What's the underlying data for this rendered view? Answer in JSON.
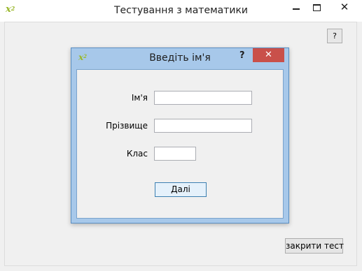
{
  "main_window": {
    "title": "Тестування з математики",
    "icon_base": "x",
    "icon_exponent": "2",
    "controls": {
      "minimize": "minimize-icon",
      "maximize": "maximize-icon",
      "close": "close-icon",
      "close_glyph": "✕"
    },
    "help_button_label": "?",
    "close_test_button_label": "закрити тест"
  },
  "dialog": {
    "title": "Введіть ім'я",
    "icon_base": "x",
    "icon_exponent": "2",
    "help_glyph": "?",
    "close_glyph": "✕",
    "colors": {
      "titlebar": "#a7c8ea",
      "close_button": "#c9504a",
      "icon_accent": "#9ab82b"
    },
    "fields": {
      "name_label": "Ім'я",
      "name_value": "",
      "surname_label": "Прізвище",
      "surname_value": "",
      "class_label": "Клас",
      "class_value": ""
    },
    "next_button_label": "Далі"
  }
}
